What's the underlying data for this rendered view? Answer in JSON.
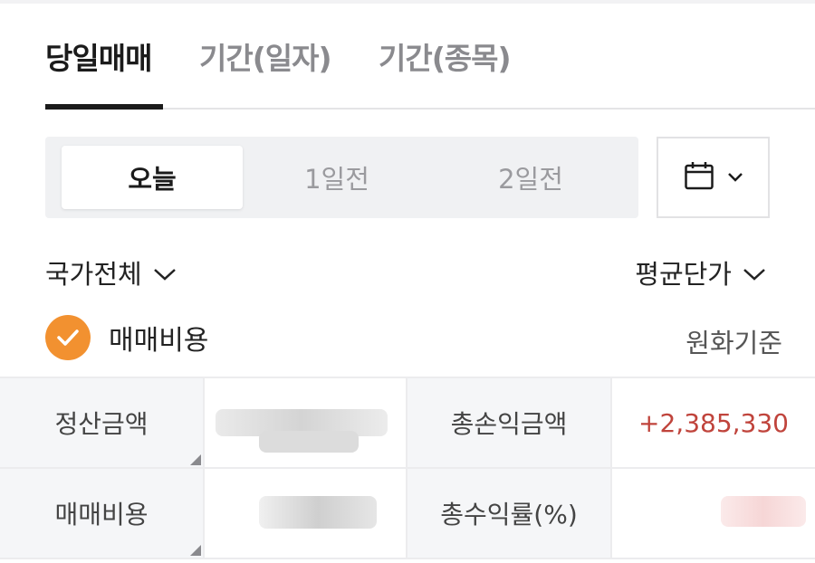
{
  "tabs": [
    {
      "label": "당일매매",
      "active": true
    },
    {
      "label": "기간(일자)",
      "active": false
    },
    {
      "label": "기간(종목)",
      "active": false
    }
  ],
  "segment": {
    "options": [
      "오늘",
      "1일전",
      "2일전"
    ],
    "selected": "오늘"
  },
  "icons": {
    "calendar": "calendar-icon",
    "chevron": "chevron-down-icon",
    "check": "check-icon"
  },
  "filters": {
    "country": "국가전체",
    "price_basis": "평균단가"
  },
  "fee_checkbox": {
    "label": "매매비용",
    "checked": true
  },
  "currency_basis": "원화기준",
  "summary": {
    "settlement_label": "정산금액",
    "total_pnl_label": "총손익금액",
    "total_pnl_value": "+2,385,330",
    "fee_label": "매매비용",
    "return_rate_label": "총수익률(%)"
  },
  "colors": {
    "accent_orange": "#f29130",
    "positive_red": "#c0443c",
    "tab_active": "#1b1b1b",
    "tab_inactive": "#8a8a8e"
  }
}
